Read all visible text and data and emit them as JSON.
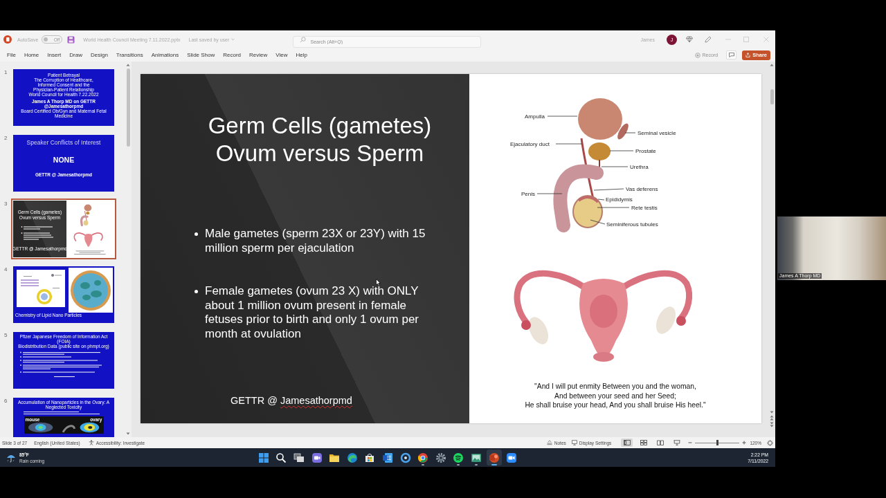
{
  "title_bar": {
    "autosave": {
      "label": "AutoSave",
      "on": false,
      "state_text": "Off"
    },
    "file_name": "World Health Council Meeting 7.11.2022.pptx",
    "save_status": "Last saved by user",
    "search": {
      "placeholder": "Search (Alt+Q)"
    },
    "user": {
      "name": "James",
      "initial": "J"
    }
  },
  "ribbon": {
    "tabs": [
      {
        "label": "File",
        "selected": false
      },
      {
        "label": "Home",
        "selected": false
      },
      {
        "label": "Insert",
        "selected": false
      },
      {
        "label": "Draw",
        "selected": false
      },
      {
        "label": "Design",
        "selected": false
      },
      {
        "label": "Transitions",
        "selected": false
      },
      {
        "label": "Animations",
        "selected": false
      },
      {
        "label": "Slide Show",
        "selected": false
      },
      {
        "label": "Record",
        "selected": false
      },
      {
        "label": "Review",
        "selected": false
      },
      {
        "label": "View",
        "selected": false
      },
      {
        "label": "Help",
        "selected": false
      }
    ],
    "record_button": "Record",
    "share_button": "Share"
  },
  "slide_panel": {
    "slides": [
      {
        "number": "1",
        "kind": "title",
        "selected": false,
        "lines": [
          "Patient Betrayal",
          "The Corruption of Healthcare,",
          "Informed Consent and the",
          "Physician-Patient Relationship",
          "World Council for Health 7.22.2022"
        ],
        "byline": "James A Thorp MD on GETTR @Jamesathorpmd",
        "subline": "Board Certified Ob/Gyn and Maternal Fetal Medicine"
      },
      {
        "number": "2",
        "kind": "statement",
        "selected": false,
        "title": "Speaker Conflicts of Interest",
        "statement": "NONE",
        "footer": "GETTR @ Jamesathorpmd"
      },
      {
        "number": "3",
        "kind": "split",
        "selected": true,
        "title_lines": [
          "Germ Cells (gametes)",
          "Ovum versus Sperm"
        ],
        "footer": "GETTR @ Jamesathorpmd"
      },
      {
        "number": "4",
        "kind": "images",
        "selected": false,
        "caption": "Chemistry of Lipid Nano Particles"
      },
      {
        "number": "5",
        "kind": "bullets",
        "selected": false,
        "title_lines": [
          "Pfizer Japanese Freedom of Information Act (FOIA)",
          "Biodistribution Data (public site on phmpt.org)"
        ]
      },
      {
        "number": "6",
        "kind": "figure",
        "selected": false,
        "title": "Accumulation of Nanoparticles in the Ovary: A Neglected Toxicity",
        "image_labels": [
          "mouse",
          "ovary"
        ]
      }
    ]
  },
  "slide": {
    "title_lines": [
      "Germ Cells (gametes)",
      "Ovum versus Sperm"
    ],
    "bullets": [
      "Male gametes (sperm 23X or 23Y) with 15 million sperm per ejaculation",
      "Female gametes (ovum 23 X) with ONLY about 1 million ovum present in female fetuses prior to birth and only 1 ovum per month at ovulation"
    ],
    "footer": {
      "prefix": "GETTR @",
      "handle": "Jamesathorpmd",
      "flagged": true
    },
    "diagram_labels": [
      "Ampulla",
      "Seminal vesicle",
      "Ejaculatory duct",
      "Prostate",
      "Urethra",
      "Penis",
      "Vas deferens",
      "Epididymis",
      "Rete testis",
      "Seminiferous tubules"
    ],
    "quote_lines": [
      "\"And I will put enmity Between you and the woman,",
      "And between your seed and her Seed;",
      "He shall bruise your head, And you shall bruise His heel.\""
    ]
  },
  "status_bar": {
    "slide_counter": "Slide 3 of 27",
    "language": "English (United States)",
    "accessibility": "Accessibility: Investigate",
    "notes": "Notes",
    "display_settings": "Display Settings",
    "views": [
      {
        "kind": "normal",
        "selected": true
      },
      {
        "kind": "sorter",
        "selected": false
      },
      {
        "kind": "reading",
        "selected": false
      },
      {
        "kind": "show",
        "selected": false
      }
    ],
    "zoom": {
      "level": 0.5,
      "reading": "120%"
    }
  },
  "taskbar": {
    "weather": {
      "temperature": "85°F",
      "condition": "Rain coming"
    },
    "apps": [
      {
        "kind": "start",
        "running": false,
        "selected": false
      },
      {
        "kind": "search",
        "running": false,
        "selected": false
      },
      {
        "kind": "taskview",
        "running": false,
        "selected": false
      },
      {
        "kind": "chat",
        "running": false,
        "selected": false
      },
      {
        "kind": "folder",
        "running": false,
        "selected": false
      },
      {
        "kind": "web",
        "running": false,
        "selected": false
      },
      {
        "kind": "store",
        "running": false,
        "selected": false
      },
      {
        "kind": "writer",
        "running": false,
        "selected": false
      },
      {
        "kind": "ring",
        "running": false,
        "selected": false
      },
      {
        "kind": "globe",
        "running": true,
        "selected": false
      },
      {
        "kind": "settings",
        "running": false,
        "selected": false
      },
      {
        "kind": "music",
        "running": true,
        "selected": false
      },
      {
        "kind": "gallery",
        "running": true,
        "selected": false
      },
      {
        "kind": "slides",
        "running": true,
        "selected": true
      },
      {
        "kind": "camera",
        "running": false,
        "selected": false
      }
    ],
    "clock": {
      "time": "2:22 PM",
      "date": "7/11/2022"
    }
  },
  "video": {
    "caption": "James A Thorp MD"
  }
}
